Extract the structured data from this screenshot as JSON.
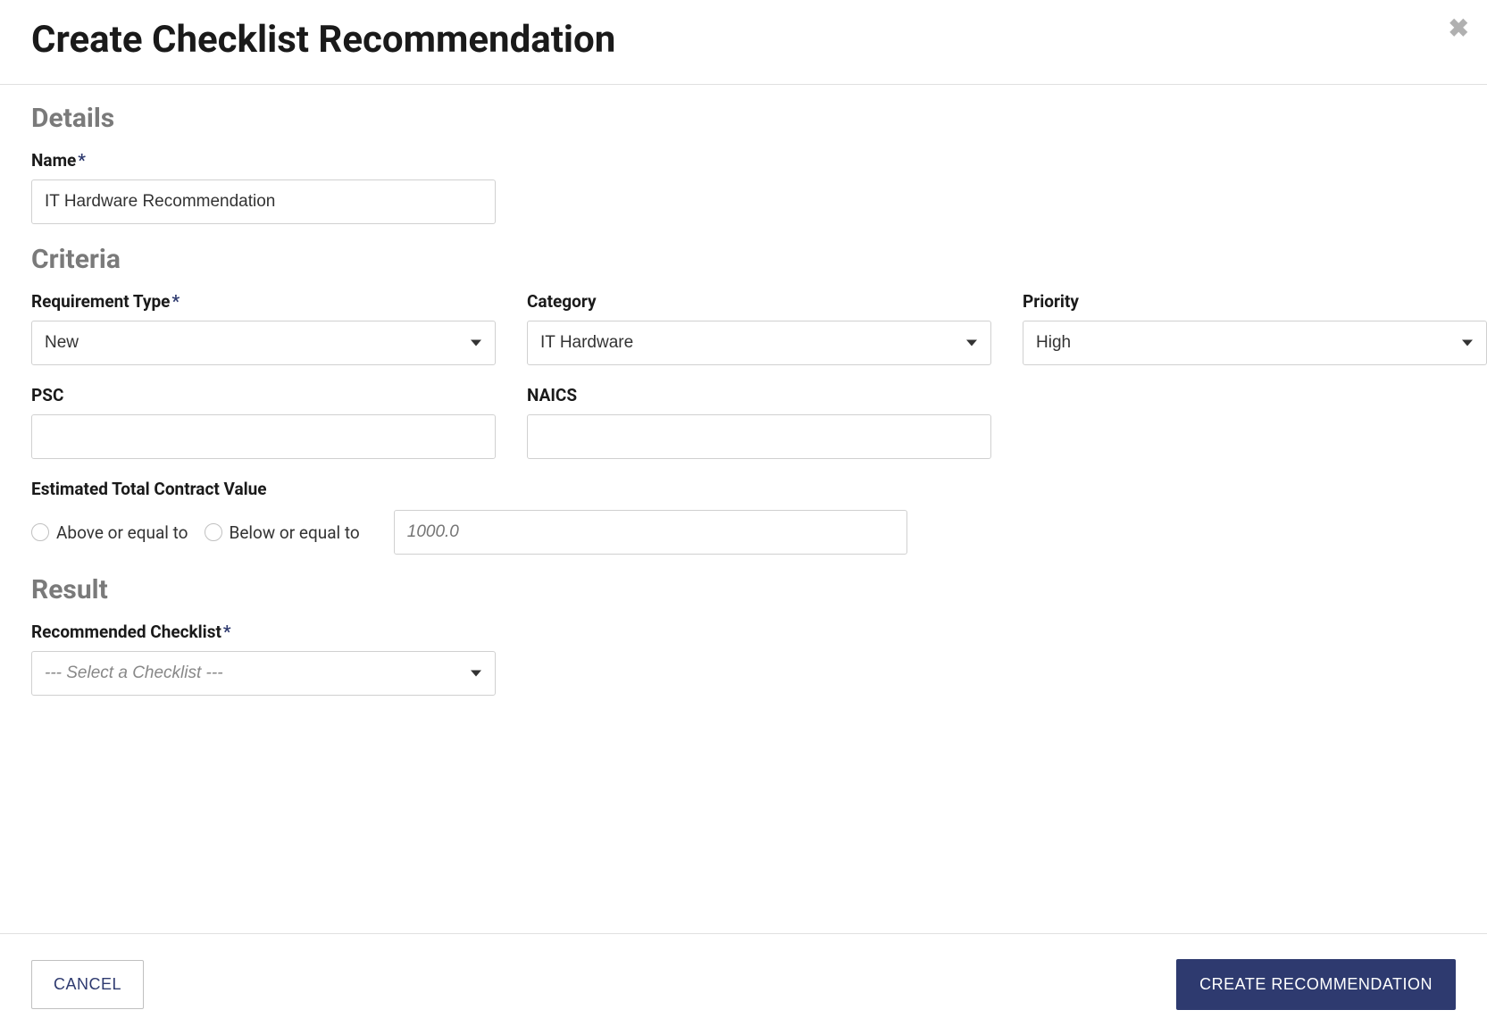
{
  "modal": {
    "title": "Create Checklist Recommendation"
  },
  "sections": {
    "details": "Details",
    "criteria": "Criteria",
    "result": "Result"
  },
  "fields": {
    "name": {
      "label": "Name",
      "value": "IT Hardware Recommendation"
    },
    "requirementType": {
      "label": "Requirement Type",
      "value": "New"
    },
    "category": {
      "label": "Category",
      "value": "IT Hardware"
    },
    "priority": {
      "label": "Priority",
      "value": "High"
    },
    "psc": {
      "label": "PSC",
      "value": ""
    },
    "naics": {
      "label": "NAICS",
      "value": ""
    },
    "estimatedTotal": {
      "label": "Estimated Total Contract Value",
      "aboveLabel": "Above or equal to",
      "belowLabel": "Below or equal to",
      "placeholder": "1000.0"
    },
    "recommendedChecklist": {
      "label": "Recommended Checklist",
      "placeholder": "--- Select a Checklist ---"
    }
  },
  "buttons": {
    "cancel": "CANCEL",
    "create": "CREATE RECOMMENDATION"
  },
  "requiredMark": "*"
}
